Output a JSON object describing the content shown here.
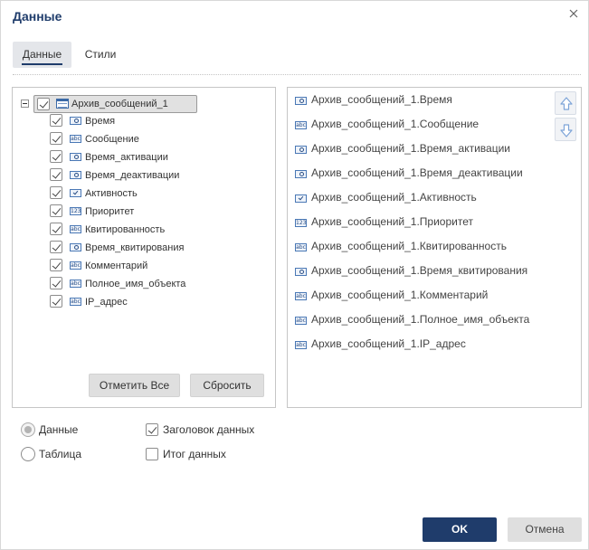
{
  "dialog": {
    "title": "Данные"
  },
  "tabs": [
    {
      "label": "Данные",
      "active": true
    },
    {
      "label": "Стили",
      "active": false
    }
  ],
  "tree": {
    "root": {
      "label": "Архив_сообщений_1",
      "checked": true,
      "icon": "table-icon"
    },
    "items": [
      {
        "label": "Время",
        "type": "time",
        "checked": true
      },
      {
        "label": "Сообщение",
        "type": "string",
        "checked": true
      },
      {
        "label": "Время_активации",
        "type": "time",
        "checked": true
      },
      {
        "label": "Время_деактивации",
        "type": "time",
        "checked": true
      },
      {
        "label": "Активность",
        "type": "bool",
        "checked": true
      },
      {
        "label": "Приоритет",
        "type": "number",
        "checked": true
      },
      {
        "label": "Квитированность",
        "type": "string",
        "checked": true
      },
      {
        "label": "Время_квитирования",
        "type": "time",
        "checked": true
      },
      {
        "label": "Комментарий",
        "type": "string",
        "checked": true
      },
      {
        "label": "Полное_имя_объекта",
        "type": "string",
        "checked": true
      },
      {
        "label": "IP_адрес",
        "type": "string",
        "checked": true
      }
    ],
    "select_all_label": "Отметить Все",
    "reset_label": "Сбросить"
  },
  "selected_fields": [
    {
      "label": "Архив_сообщений_1.Время",
      "type": "time"
    },
    {
      "label": "Архив_сообщений_1.Сообщение",
      "type": "string"
    },
    {
      "label": "Архив_сообщений_1.Время_активации",
      "type": "time"
    },
    {
      "label": "Архив_сообщений_1.Время_деактивации",
      "type": "time"
    },
    {
      "label": "Архив_сообщений_1.Активность",
      "type": "bool"
    },
    {
      "label": "Архив_сообщений_1.Приоритет",
      "type": "number"
    },
    {
      "label": "Архив_сообщений_1.Квитированность",
      "type": "string"
    },
    {
      "label": "Архив_сообщений_1.Время_квитирования",
      "type": "time"
    },
    {
      "label": "Архив_сообщений_1.Комментарий",
      "type": "string"
    },
    {
      "label": "Архив_сообщений_1.Полное_имя_объекта",
      "type": "string"
    },
    {
      "label": "Архив_сообщений_1.IP_адрес",
      "type": "string"
    }
  ],
  "type_icons": {
    "string": "abc",
    "number": "123"
  },
  "options": {
    "view": [
      {
        "label": "Данные",
        "checked": true
      },
      {
        "label": "Таблица",
        "checked": false
      }
    ],
    "flags": [
      {
        "label": "Заголовок данных",
        "checked": true
      },
      {
        "label": "Итог данных",
        "checked": false
      }
    ]
  },
  "footer": {
    "ok_label": "OK",
    "cancel_label": "Отмена"
  },
  "colors": {
    "primary": "#1f3c6b",
    "button_gray": "#dfdfdf",
    "arrow_icon": "#7da4d8"
  }
}
